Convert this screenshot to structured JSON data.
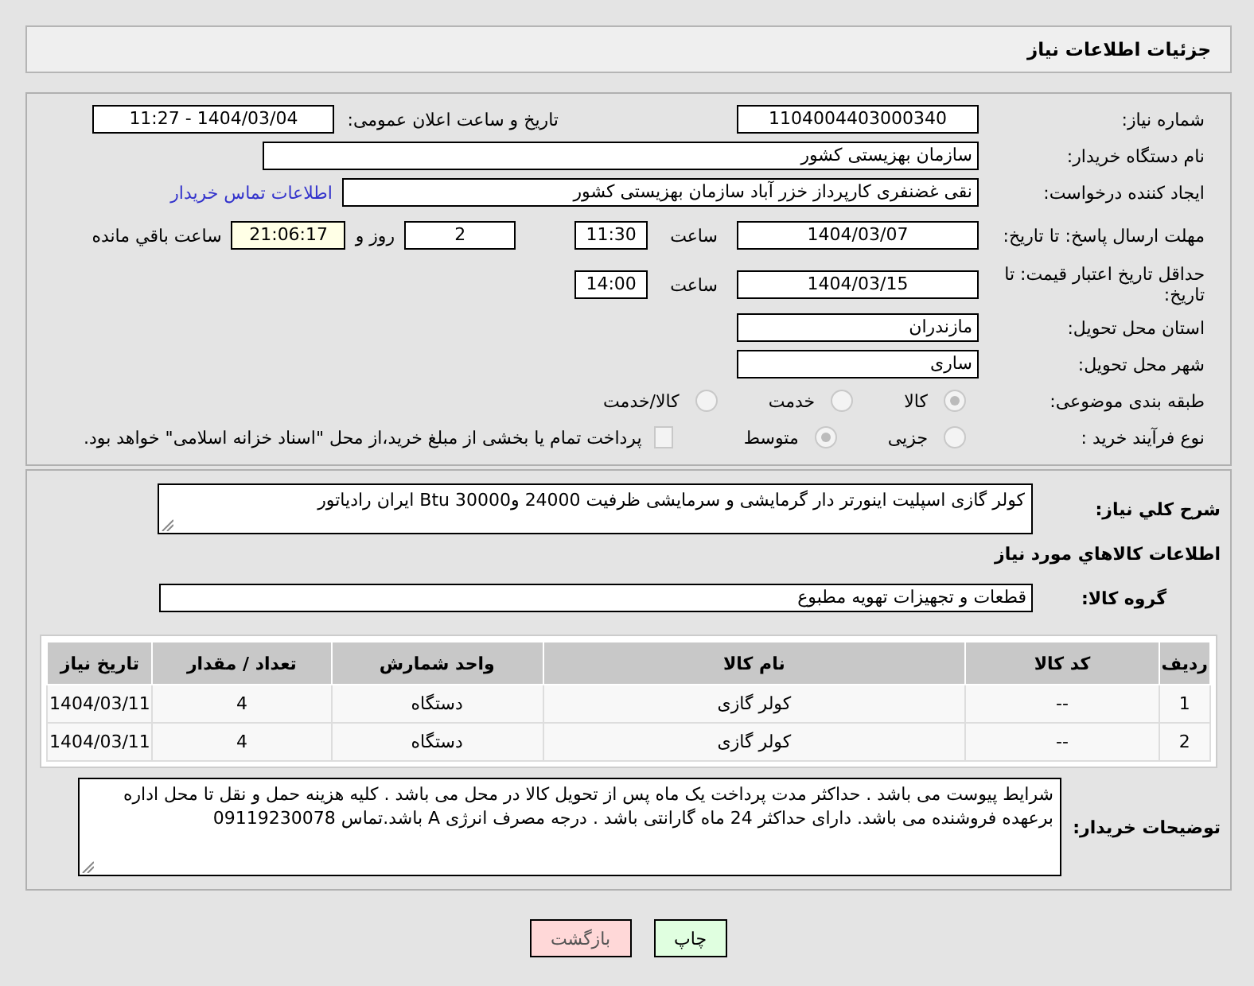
{
  "header": {
    "title": "جزئیات اطلاعات نیاز"
  },
  "need_number": {
    "label": "شماره نیاز:",
    "value": "1104004403000340"
  },
  "announce": {
    "label": "تاریخ و ساعت اعلان عمومی:",
    "value": "1404/03/04 - 11:27"
  },
  "buyer_org": {
    "label": "نام دستگاه خریدار:",
    "value": "سازمان بهزیستی کشور"
  },
  "creator": {
    "label": "ایجاد کننده درخواست:",
    "value": "نقی غضنفری کارپرداز خزر آباد سازمان بهزیستی کشور",
    "link": "اطلاعات تماس خریدار"
  },
  "deadline": {
    "label": "مهلت ارسال پاسخ: تا تاریخ:",
    "date": "1404/03/07",
    "time_label": "ساعت",
    "time": "11:30",
    "days": "2",
    "days_label": "روز و",
    "remaining": "21:06:17",
    "remaining_label": "ساعت باقي مانده"
  },
  "validity": {
    "label": "حداقل تاریخ اعتبار قیمت: تا تاریخ:",
    "date": "1404/03/15",
    "time_label": "ساعت",
    "time": "14:00"
  },
  "province": {
    "label": "استان محل تحویل:",
    "value": "مازندران"
  },
  "city": {
    "label": "شهر محل تحویل:",
    "value": "ساری"
  },
  "category": {
    "label": "طبقه بندی موضوعی:",
    "options": [
      {
        "label": "کالا",
        "selected": true
      },
      {
        "label": "خدمت",
        "selected": false
      },
      {
        "label": "کالا/خدمت",
        "selected": false
      }
    ]
  },
  "process": {
    "label": "نوع فرآیند خرید :",
    "options": [
      {
        "label": "جزیی",
        "selected": false
      },
      {
        "label": "متوسط",
        "selected": true
      }
    ],
    "treasury": {
      "label": "پرداخت تمام یا بخشی از مبلغ خرید،از محل \"اسناد خزانه اسلامی\" خواهد بود.",
      "checked": false
    }
  },
  "description": {
    "label": "شرح کلي نياز:",
    "value": "کولر گازی اسپلیت اینورتر دار گرمایشی و سرمایشی ظرفیت 24000 و30000 Btu ایران رادیاتور"
  },
  "goods_heading": "اطلاعات کالاهاي مورد نياز",
  "goods_group": {
    "label": "گروه کالا:",
    "value": "قطعات و تجهیزات تهویه مطبوع"
  },
  "table": {
    "columns": [
      "ردیف",
      "کد کالا",
      "نام کالا",
      "واحد شمارش",
      "تعداد / مقدار",
      "تاریخ نیاز"
    ],
    "rows": [
      [
        "1",
        "--",
        "کولر گازی",
        "دستگاه",
        "4",
        "1404/03/11"
      ],
      [
        "2",
        "--",
        "کولر گازی",
        "دستگاه",
        "4",
        "1404/03/11"
      ]
    ]
  },
  "buyer_notes": {
    "label": "توضیحات خریدار:",
    "value": "شرایط پیوست می باشد . حداکثر مدت پرداخت یک ماه پس از تحویل کالا در محل می باشد . کلیه هزینه حمل و نقل تا محل اداره برعهده فروشنده می باشد. دارای حداکثر 24 ماه گارانتی باشد . درجه مصرف انرژی A باشد.تماس 09119230078"
  },
  "buttons": [
    {
      "label": "چاپ",
      "kind": "print"
    },
    {
      "label": "بازگشت",
      "kind": "back"
    }
  ]
}
